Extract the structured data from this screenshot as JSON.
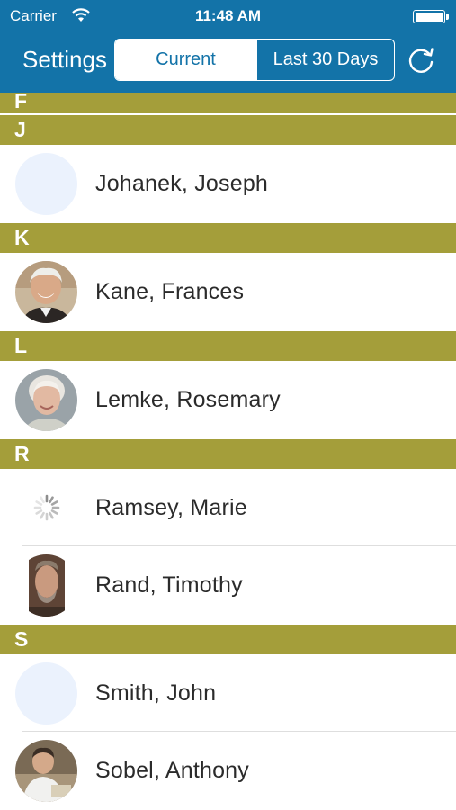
{
  "status_bar": {
    "carrier": "Carrier",
    "time": "11:48 AM",
    "wifi_icon": "wifi-icon",
    "battery_icon": "battery-icon"
  },
  "nav": {
    "settings_label": "Settings",
    "segments": [
      "Current",
      "Last 30 Days"
    ],
    "selected_segment": "Current",
    "refresh_icon": "refresh-icon"
  },
  "colors": {
    "header": "#1373a8",
    "section_header": "#a49e3a",
    "placeholder_avatar": "#ebf2fd"
  },
  "sections": [
    {
      "letter": "F",
      "contacts": []
    },
    {
      "letter": "J",
      "contacts": [
        {
          "name": "Johanek, Joseph",
          "avatar": "placeholder"
        }
      ]
    },
    {
      "letter": "K",
      "contacts": [
        {
          "name": "Kane, Frances",
          "avatar": "photo"
        }
      ]
    },
    {
      "letter": "L",
      "contacts": [
        {
          "name": "Lemke, Rosemary",
          "avatar": "photo"
        }
      ]
    },
    {
      "letter": "R",
      "contacts": [
        {
          "name": "Ramsey, Marie",
          "avatar": "loading"
        },
        {
          "name": "Rand, Timothy",
          "avatar": "photo"
        }
      ]
    },
    {
      "letter": "S",
      "contacts": [
        {
          "name": "Smith, John",
          "avatar": "placeholder"
        },
        {
          "name": "Sobel, Anthony",
          "avatar": "photo"
        }
      ]
    }
  ]
}
